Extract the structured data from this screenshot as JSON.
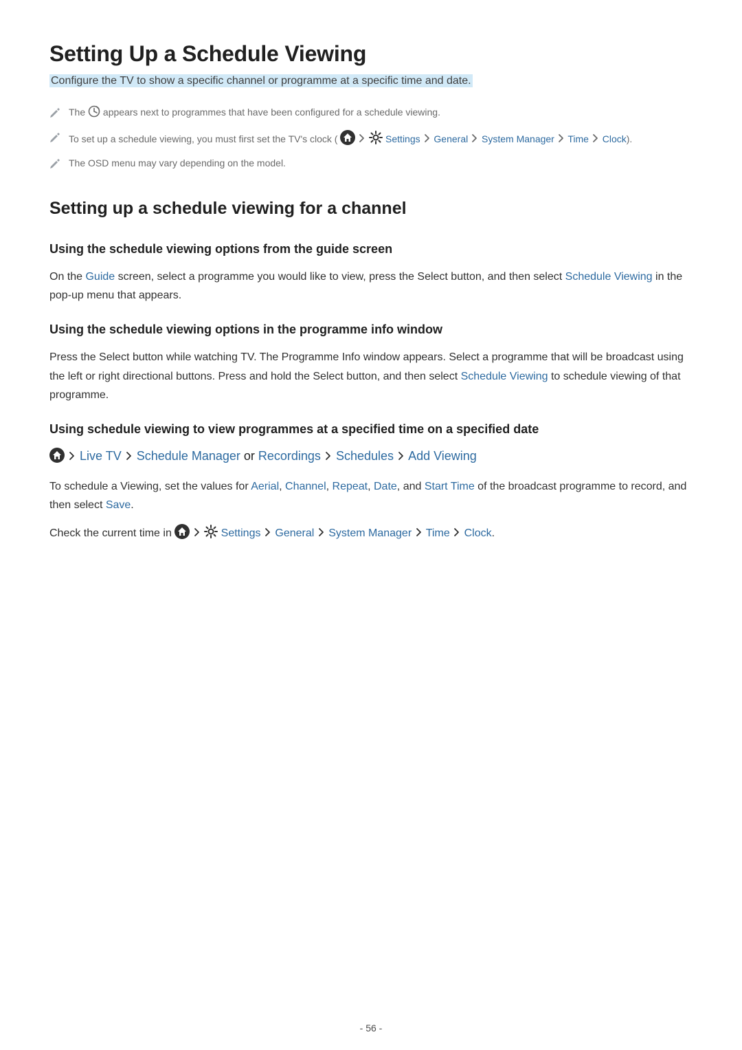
{
  "page_number": "- 56 -",
  "heading1": "Setting Up a Schedule Viewing",
  "subtitle": "Configure the TV to show a specific channel or programme at a specific time and date.",
  "notes": {
    "n1_a": "The ",
    "n1_b": " appears next to programmes that have been configured for a schedule viewing.",
    "n2_a": "To set up a schedule viewing, you must first set the TV's clock (",
    "n2_settings": "Settings",
    "n2_general": "General",
    "n2_sysmgr": "System Manager",
    "n2_time": "Time",
    "n2_clock": "Clock",
    "n2_close": ").",
    "n3": "The OSD menu may vary depending on the model."
  },
  "heading2": "Setting up a schedule viewing for a channel",
  "sec1": {
    "h3": "Using the schedule viewing options from the guide screen",
    "p_a": "On the ",
    "p_guide": "Guide",
    "p_b": " screen, select a programme you would like to view, press the Select button, and then select ",
    "p_sched": "Schedule Viewing",
    "p_c": " in the pop-up menu that appears."
  },
  "sec2": {
    "h3": "Using the schedule viewing options in the programme info window",
    "p_a": "Press the Select button while watching TV. The Programme Info window appears. Select a programme that will be broadcast using the left or right directional buttons. Press and hold the Select button, and then select ",
    "p_sched": "Schedule Viewing",
    "p_b": " to schedule viewing of that programme."
  },
  "sec3": {
    "h3": "Using schedule viewing to view programmes at a specified time on a specified date",
    "path": {
      "live_tv": "Live TV",
      "sched_mgr": "Schedule Manager",
      "or": " or ",
      "recordings": "Recordings",
      "schedules": "Schedules",
      "add_viewing": "Add Viewing"
    },
    "p1_a": "To schedule a Viewing, set the values for ",
    "p1_aerial": "Aerial",
    "p1_c1": ", ",
    "p1_channel": "Channel",
    "p1_c2": ", ",
    "p1_repeat": "Repeat",
    "p1_c3": ", ",
    "p1_date": "Date",
    "p1_c4": ", and ",
    "p1_start": "Start Time",
    "p1_b": " of the broadcast programme to record, and then select ",
    "p1_save": "Save",
    "p1_end": ".",
    "p2_a": "Check the current time in ",
    "p2_settings": "Settings",
    "p2_general": "General",
    "p2_sysmgr": "System Manager",
    "p2_time": "Time",
    "p2_clock": "Clock",
    "p2_end": "."
  }
}
